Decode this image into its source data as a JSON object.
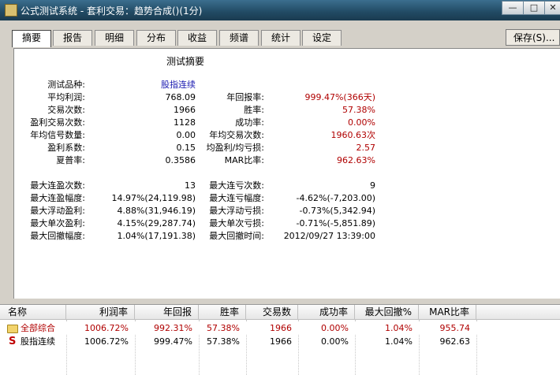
{
  "window": {
    "title": "公式测试系统 - 套利交易：趋势合成()(1分)",
    "controls": {
      "minimize": "—",
      "maximize": "□",
      "close": "✕"
    }
  },
  "tabs": [
    "摘要",
    "报告",
    "明细",
    "分布",
    "收益",
    "频谱",
    "统计",
    "设定"
  ],
  "active_tab": "摘要",
  "save_button": "保存(S)...",
  "summary": {
    "title": "测试摘要",
    "product_label": "测试品种:",
    "product_value": "股指连续",
    "left": [
      {
        "label": "平均利润:",
        "value": "768.09"
      },
      {
        "label": "交易次数:",
        "value": "1966"
      },
      {
        "label": "盈利交易次数:",
        "value": "1128"
      },
      {
        "label": "年均信号数量:",
        "value": "0.00"
      },
      {
        "label": "盈利系数:",
        "value": "0.15"
      },
      {
        "label": "夏普率:",
        "value": "0.3586"
      }
    ],
    "right": [
      {
        "label": "年回报率:",
        "value": "999.47%(366天)"
      },
      {
        "label": "胜率:",
        "value": "57.38%"
      },
      {
        "label": "成功率:",
        "value": "0.00%"
      },
      {
        "label": "年均交易次数:",
        "value": "1960.63次"
      },
      {
        "label": "均盈利/均亏损:",
        "value": "2.57"
      },
      {
        "label": "MAR比率:",
        "value": "962.63%"
      }
    ],
    "left2": [
      {
        "label": "最大连盈次数:",
        "value": "13"
      },
      {
        "label": "最大连盈幅度:",
        "value": "14.97%(24,119.98)"
      },
      {
        "label": "最大浮动盈利:",
        "value": "4.88%(31,946.19)"
      },
      {
        "label": "最大单次盈利:",
        "value": "4.15%(29,287.74)"
      },
      {
        "label": "最大回撤幅度:",
        "value": "1.04%(17,191.38)"
      }
    ],
    "right2": [
      {
        "label": "最大连亏次数:",
        "value": "9"
      },
      {
        "label": "最大连亏幅度:",
        "value": "-4.62%(-7,203.00)"
      },
      {
        "label": "最大浮动亏损:",
        "value": "-0.73%(5,342.94)"
      },
      {
        "label": "最大单次亏损:",
        "value": "-0.71%(-5,851.89)"
      },
      {
        "label": "最大回撤时间:",
        "value": "2012/09/27 13:39:00"
      }
    ]
  },
  "list": {
    "columns": [
      "名称",
      "利润率",
      "年回报",
      "胜率",
      "交易数",
      "成功率",
      "最大回撤%",
      "MAR比率"
    ],
    "rows": [
      {
        "icon": "folder-icon",
        "cells": [
          "全部综合",
          "1006.72%",
          "992.31%",
          "57.38%",
          "1966",
          "0.00%",
          "1.04%",
          "955.74"
        ]
      },
      {
        "icon": "s-icon",
        "icon_text": "S",
        "cells": [
          "股指连续",
          "1006.72%",
          "999.47%",
          "57.38%",
          "1966",
          "0.00%",
          "1.04%",
          "962.63"
        ]
      }
    ]
  },
  "colors": {
    "accent_red": "#b00000",
    "accent_blue": "#1a1ab0"
  }
}
